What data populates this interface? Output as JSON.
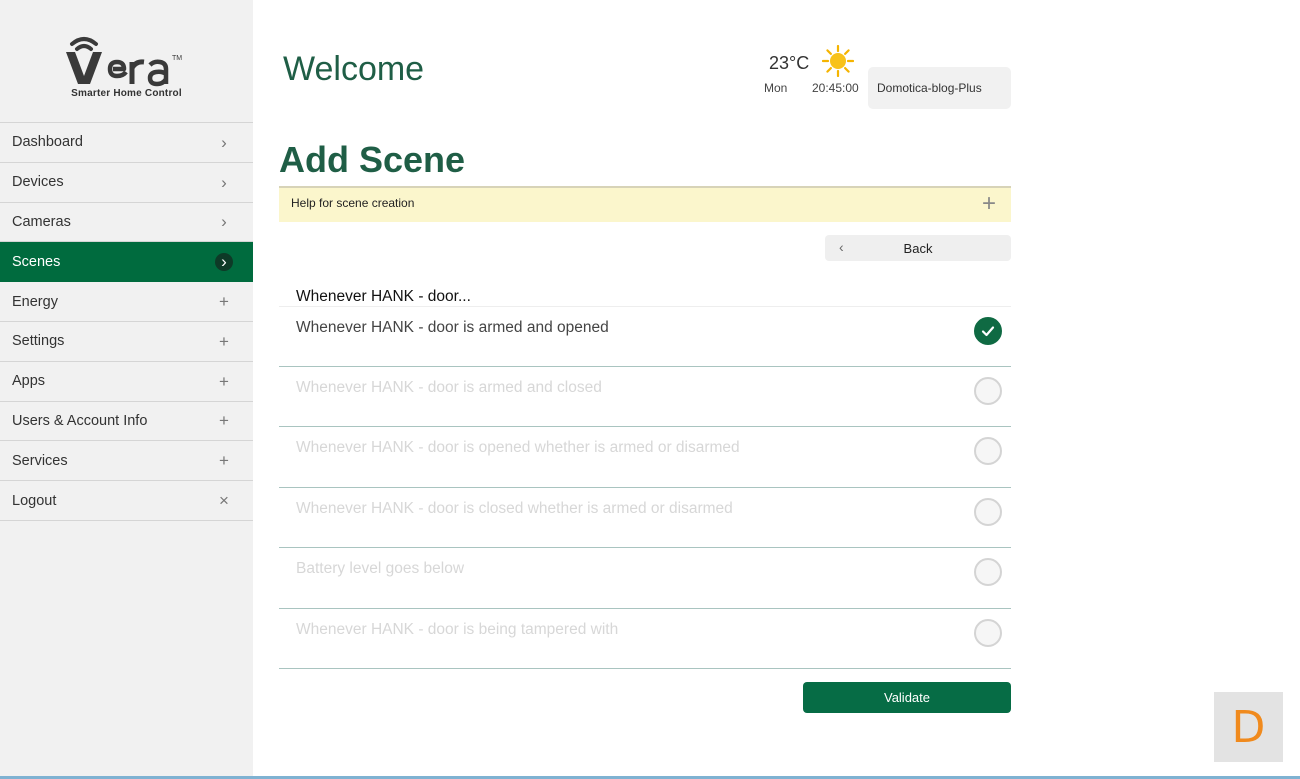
{
  "brand": {
    "logo_text": "Vera",
    "trademark": "TM",
    "tagline": "Smarter Home Control"
  },
  "sidebar": {
    "items": [
      {
        "label": "Dashboard",
        "indicator": "›",
        "active": false
      },
      {
        "label": "Devices",
        "indicator": "›",
        "active": false
      },
      {
        "label": "Cameras",
        "indicator": "›",
        "active": false
      },
      {
        "label": "Scenes",
        "indicator": "›",
        "active": true
      },
      {
        "label": "Energy",
        "indicator": "+",
        "active": false
      },
      {
        "label": "Settings",
        "indicator": "+",
        "active": false
      },
      {
        "label": "Apps",
        "indicator": "+",
        "active": false
      },
      {
        "label": "Users & Account Info",
        "indicator": "+",
        "active": false
      },
      {
        "label": "Services",
        "indicator": "+",
        "active": false
      },
      {
        "label": "Logout",
        "indicator": "×",
        "active": false
      }
    ]
  },
  "header": {
    "welcome": "Welcome",
    "weather": {
      "temperature": "23°C",
      "icon": "sun-icon",
      "day": "Mon",
      "time": "20:45:00"
    },
    "account_name": "Domotica-blog-Plus"
  },
  "main": {
    "title": "Add Scene",
    "help_text": "Help for scene creation",
    "help_toggle": "+",
    "back_label": "Back",
    "back_icon": "‹",
    "group_title": "Whenever HANK - door...",
    "options": [
      {
        "label": "Whenever HANK - door is armed and opened",
        "selected": true
      },
      {
        "label": "Whenever HANK - door is armed and closed",
        "selected": false
      },
      {
        "label": "Whenever HANK - door is opened whether is armed or disarmed",
        "selected": false
      },
      {
        "label": "Whenever HANK - door is closed whether is armed or disarmed",
        "selected": false
      },
      {
        "label": "Battery level goes below",
        "selected": false
      },
      {
        "label": "Whenever HANK - door is being tampered with",
        "selected": false
      }
    ],
    "validate_label": "Validate"
  },
  "corner_badge": "D",
  "colors": {
    "brand_green": "#006b3e",
    "title_green": "#1f5e46",
    "help_bg": "#fbf6cc",
    "badge_orange": "#f08a1d"
  }
}
